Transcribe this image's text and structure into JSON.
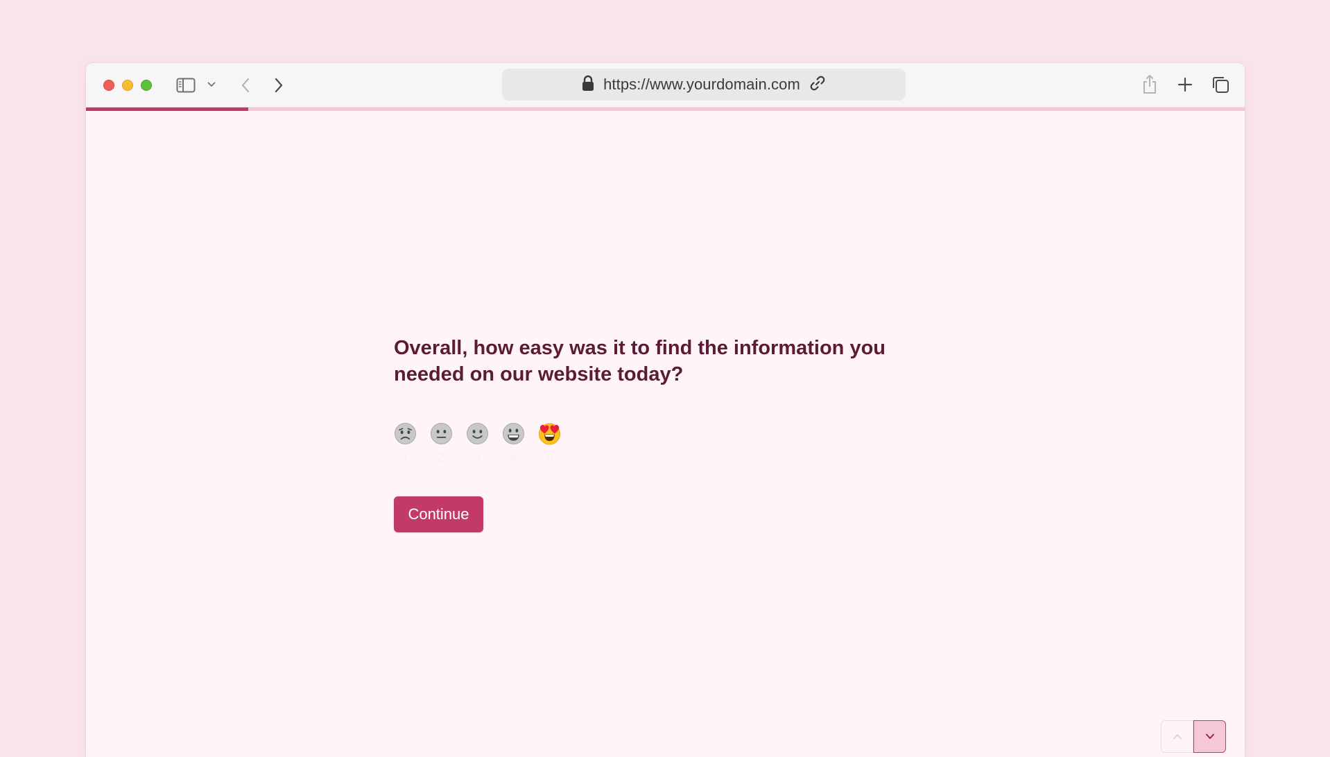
{
  "browser": {
    "url": "https://www.yourdomain.com"
  },
  "survey": {
    "progress": 0.14,
    "question": "Overall, how easy was it to find the information you needed on our website today?",
    "rating": {
      "selected": 5,
      "options": [
        {
          "value": "1",
          "icon": "anxious-face-icon"
        },
        {
          "value": "2",
          "icon": "neutral-face-icon"
        },
        {
          "value": "3",
          "icon": "slightly-smiling-face-icon"
        },
        {
          "value": "4",
          "icon": "grinning-face-icon"
        },
        {
          "value": "5",
          "icon": "heart-eyes-face-icon"
        }
      ]
    },
    "continue_label": "Continue"
  },
  "colors": {
    "accent": "#c23a66",
    "question_text": "#5a1b34",
    "page_bg": "#fff5f8"
  }
}
